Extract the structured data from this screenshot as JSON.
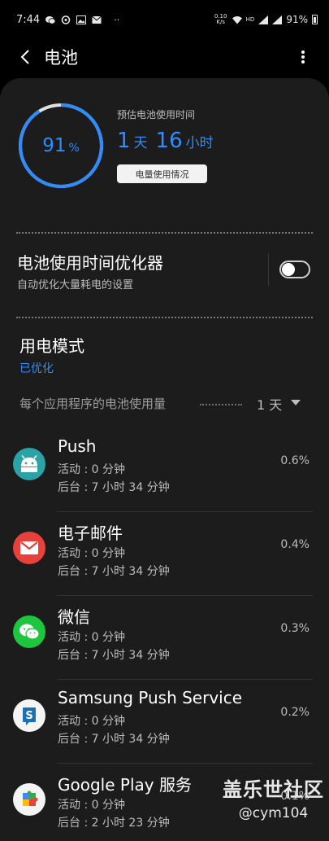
{
  "status_bar": {
    "time": "7:44",
    "net_speed_value": "0.10",
    "net_speed_unit": "K/s",
    "battery": "91%"
  },
  "app_bar": {
    "title": "电池"
  },
  "summary": {
    "ring_value": "91",
    "ring_unit": "%",
    "battery_fraction": 0.91,
    "estimate_label": "预估电池使用时间",
    "estimate_days": "1",
    "estimate_days_unit": "天",
    "estimate_hours": "16",
    "estimate_hours_unit": "小时",
    "usage_button": "电量使用情况"
  },
  "optimizer": {
    "title": "电池使用时间优化器",
    "subtitle": "自动优化大量耗电的设置",
    "enabled": false
  },
  "power_mode": {
    "title": "用电模式",
    "value": "已优化"
  },
  "per_app": {
    "label": "每个应用程序的电池使用量",
    "period": "1 天"
  },
  "apps": [
    {
      "name": "Push",
      "active": "活动 : 0 分钟",
      "background": "后台 : 7 小时 34 分钟",
      "percent": "0.6%",
      "icon": "android-icon"
    },
    {
      "name": "电子邮件",
      "active": "活动 : 0 分钟",
      "background": "后台 : 7 小时 34 分钟",
      "percent": "0.4%",
      "icon": "email-icon"
    },
    {
      "name": "微信",
      "active": "活动 : 0 分钟",
      "background": "后台 : 7 小时 34 分钟",
      "percent": "0.3%",
      "icon": "wechat-icon"
    },
    {
      "name": "Samsung Push Service",
      "active": "活动 : 0 分钟",
      "background": "后台 : 7 小时 34 分钟",
      "percent": "0.2%",
      "icon": "samsung-push-icon"
    },
    {
      "name": "Google Play 服务",
      "active": "活动 : 0 分钟",
      "background": "后台 : 2 小时 23 分钟",
      "percent": "0.1%",
      "icon": "google-play-services-icon"
    }
  ],
  "watermark": {
    "title": "盖乐世社区",
    "user": "@cym104"
  },
  "colors": {
    "accent": "#2f8cff",
    "panel": "#1c1c1c",
    "background": "#000000"
  }
}
